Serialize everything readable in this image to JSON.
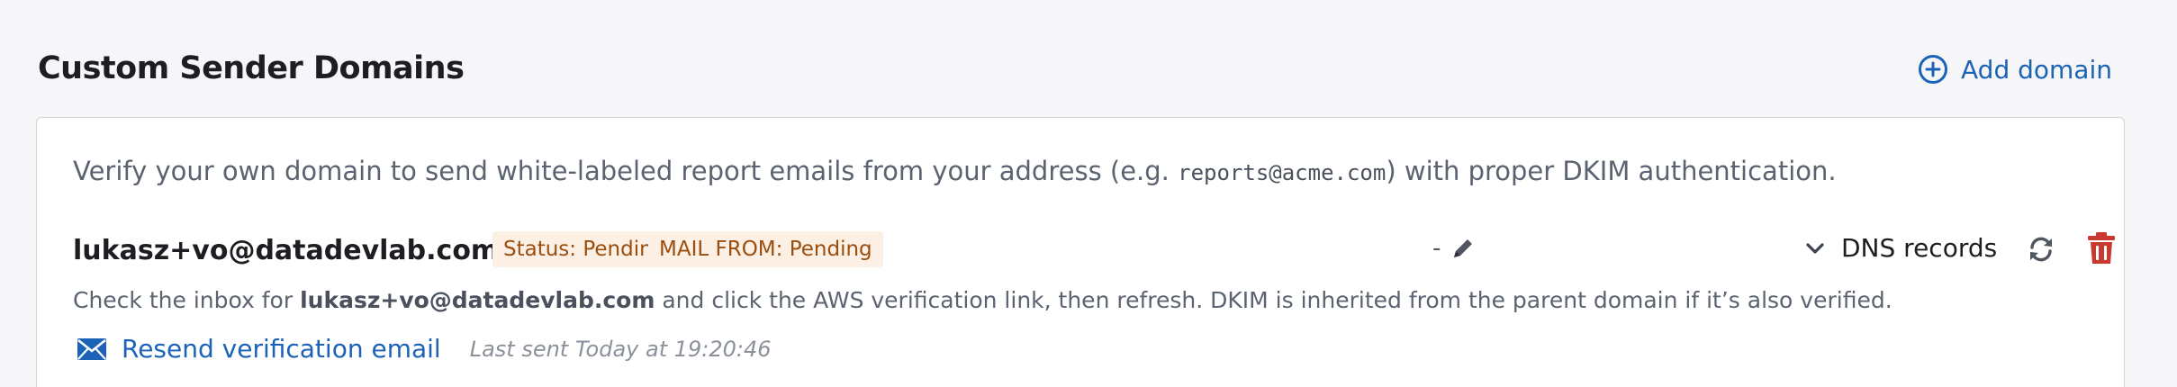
{
  "section": {
    "title": "Custom Sender Domains",
    "add_domain_label": "Add domain"
  },
  "intro": {
    "text_before": "Verify your own domain to send white-labeled report emails from your address (e.g. ",
    "example_address": "reports@acme.com",
    "text_after": ") with proper DKIM authentication."
  },
  "domain": {
    "email": "lukasz+vo@datadevlab.com",
    "status_badge": "Status: Pending",
    "mail_from_badge": "MAIL FROM: Pending",
    "display_value": "-",
    "dns_records_label": "DNS records",
    "help_before": "Check the inbox for ",
    "help_email": "lukasz+vo@datadevlab.com",
    "help_after": " and click the AWS verification link, then refresh. DKIM is inherited from the parent domain if it’s also verified.",
    "resend_label": "Resend verification email",
    "last_sent": "Last sent Today at 19:20:46"
  },
  "colors": {
    "accent": "#1c63b7",
    "badge_bg": "#fcefe3",
    "badge_text": "#9a4f10",
    "delete": "#c8392f"
  },
  "icons": {
    "add": "plus-circle-icon",
    "edit": "pencil-icon",
    "expand": "chevron-down-icon",
    "refresh": "refresh-icon",
    "delete": "trash-icon",
    "resend": "envelope-icon"
  }
}
